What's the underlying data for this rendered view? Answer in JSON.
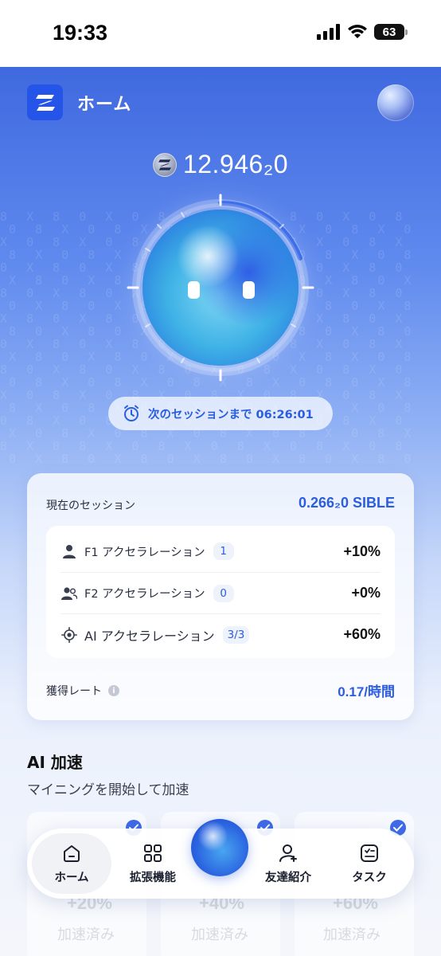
{
  "status_bar": {
    "time": "19:33",
    "battery": "63"
  },
  "header": {
    "title": "ホーム"
  },
  "balance": {
    "value": "12.946₂0"
  },
  "session_timer": {
    "label": "次のセッションまで 06:26:01"
  },
  "current_session": {
    "title": "現在のセッション",
    "value": "0.266₂0 SIBLE",
    "accelerations": [
      {
        "label": "F1 アクセラレーション",
        "badge": "1",
        "pct": "+10%"
      },
      {
        "label": "F2 アクセラレーション",
        "badge": "0",
        "pct": "+0%"
      },
      {
        "label": "AI アクセラレーション",
        "badge": "3/3",
        "pct": "+60%"
      }
    ],
    "rate_label": "獲得レート",
    "rate_value": "0.17/時間"
  },
  "ai_boost": {
    "title": "AI 加速",
    "subtitle": "マイニングを開始して加速",
    "cards": [
      {
        "pct": "+20%",
        "status": "加速済み"
      },
      {
        "pct": "+40%",
        "status": "加速済み"
      },
      {
        "pct": "+60%",
        "status": "加速済み"
      }
    ]
  },
  "tabbar": {
    "items": [
      {
        "label": "ホーム",
        "icon": "home-icon"
      },
      {
        "label": "拡張機能",
        "icon": "grid-icon"
      },
      {
        "label": "友達紹介",
        "icon": "user-plus-icon"
      },
      {
        "label": "タスク",
        "icon": "task-list-icon"
      }
    ]
  },
  "colors": {
    "accent": "#2b5de0",
    "header_bg": "#3f69df",
    "logo_bg": "#2454e8"
  }
}
